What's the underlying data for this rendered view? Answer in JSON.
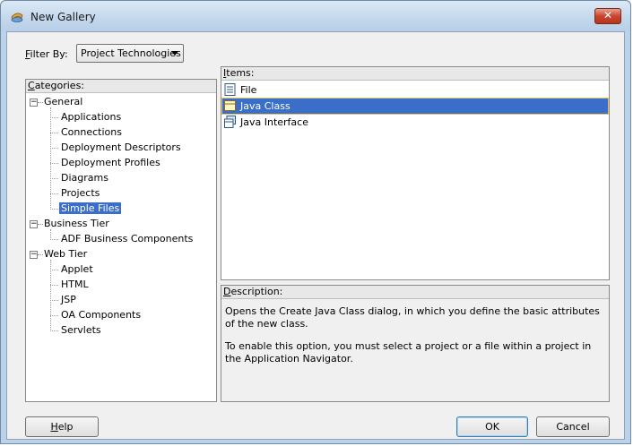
{
  "window": {
    "title": "New Gallery",
    "close_glyph": "✕"
  },
  "filter": {
    "label_pre": "",
    "label_u": "F",
    "label_post": "ilter By:",
    "selected": "Project Technologies"
  },
  "categories": {
    "header_u": "C",
    "header_rest": "ategories:",
    "groups": [
      {
        "label": "General",
        "children": [
          "Applications",
          "Connections",
          "Deployment Descriptors",
          "Deployment Profiles",
          "Diagrams",
          "Projects",
          "Simple Files"
        ]
      },
      {
        "label": "Business Tier",
        "children": [
          "ADF Business Components"
        ]
      },
      {
        "label": "Web Tier",
        "children": [
          "Applet",
          "HTML",
          "JSP",
          "OA Components",
          "Servlets"
        ]
      }
    ],
    "selected": "Simple Files"
  },
  "items": {
    "header_u": "I",
    "header_rest": "tems:",
    "list": [
      {
        "label": "File",
        "icon": "file-icon"
      },
      {
        "label": "Java Class",
        "icon": "java-class-icon"
      },
      {
        "label": "Java Interface",
        "icon": "java-interface-icon"
      }
    ],
    "selected": "Java Class"
  },
  "description": {
    "header_u": "D",
    "header_rest": "escription:",
    "paragraphs": [
      "Opens the Create Java Class dialog, in which you define the basic attributes of the new class.",
      "To enable this option, you must select a project or a file within a project in the Application Navigator."
    ]
  },
  "buttons": {
    "help_u": "H",
    "help_rest": "elp",
    "ok": "OK",
    "cancel": "Cancel"
  },
  "colors": {
    "selection": "#3a6ec9",
    "frame": "#bcd2e8",
    "close": "#c9452e"
  }
}
